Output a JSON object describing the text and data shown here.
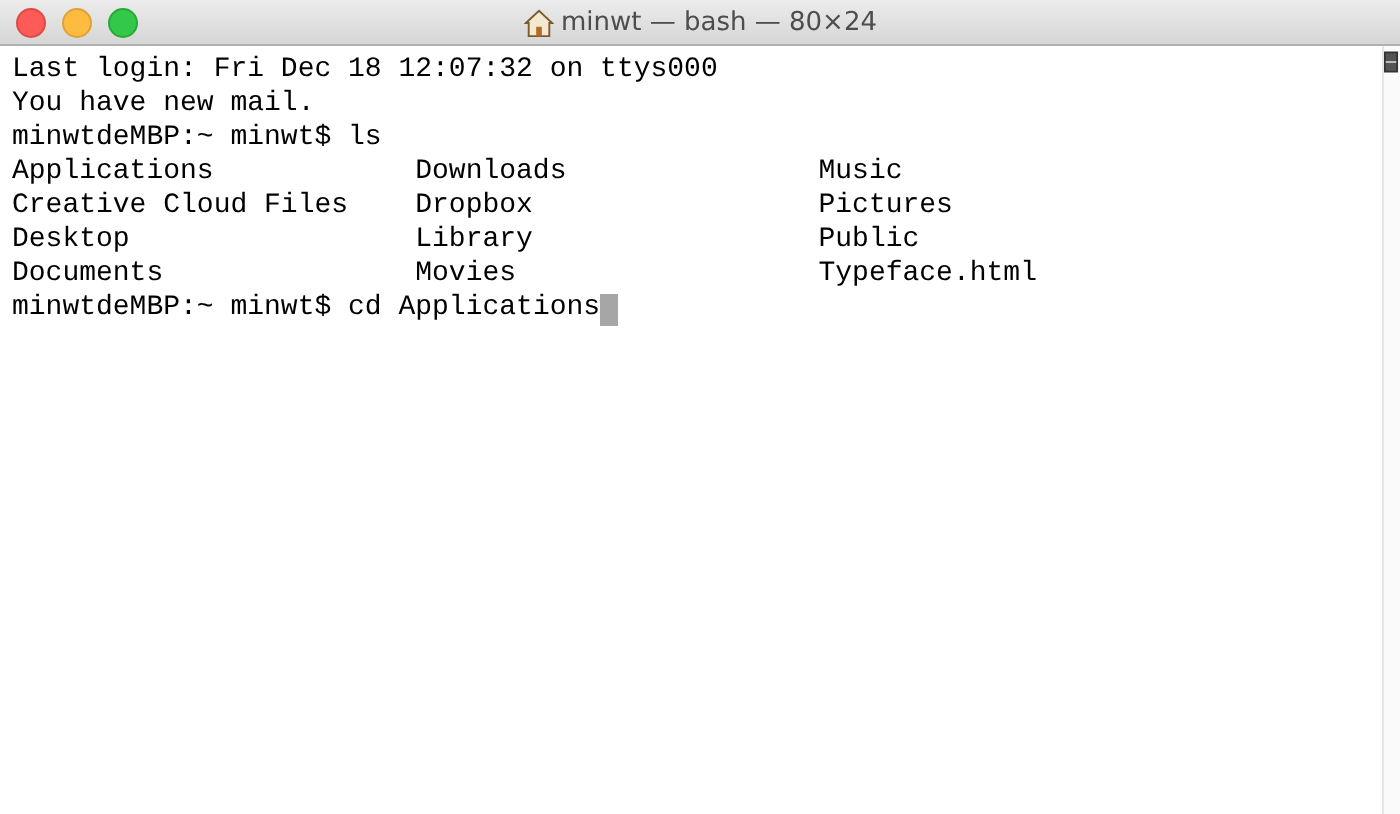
{
  "window": {
    "title": "minwt — bash — 80×24"
  },
  "terminal": {
    "lines": [
      {
        "kind": "text",
        "text": "Last login: Fri Dec 18 12:07:32 on ttys000"
      },
      {
        "kind": "text",
        "text": "You have new mail."
      },
      {
        "kind": "text",
        "text": "minwtdeMBP:~ minwt$ ls"
      },
      {
        "kind": "columns",
        "cells": [
          "Applications",
          "Downloads",
          "Music"
        ]
      },
      {
        "kind": "columns",
        "cells": [
          "Creative Cloud Files",
          "Dropbox",
          "Pictures"
        ]
      },
      {
        "kind": "columns",
        "cells": [
          "Desktop",
          "Library",
          "Public"
        ]
      },
      {
        "kind": "columns",
        "cells": [
          "Documents",
          "Movies",
          "Typeface.html"
        ]
      },
      {
        "kind": "prompt",
        "text": "minwtdeMBP:~ minwt$ cd Applications",
        "cursor": true
      }
    ]
  }
}
